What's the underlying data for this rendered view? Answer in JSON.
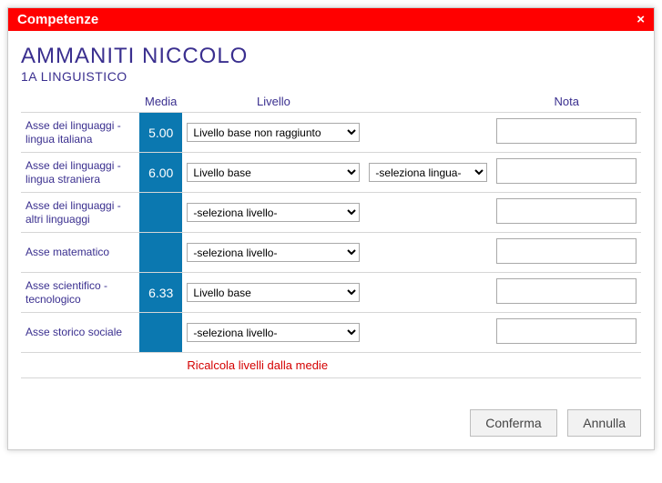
{
  "dialog": {
    "title": "Competenze",
    "close_glyph": "×"
  },
  "student": {
    "name": "AMMANITI NICCOLO",
    "class": "1A LINGUISTICO"
  },
  "headers": {
    "media": "Media",
    "livello": "Livello",
    "nota": "Nota"
  },
  "rows": [
    {
      "axis": "Asse dei linguaggi - lingua italiana",
      "media": "5.00",
      "level": "Livello base non raggiunto",
      "lang": "",
      "note": ""
    },
    {
      "axis": "Asse dei linguaggi - lingua straniera",
      "media": "6.00",
      "level": "Livello base",
      "lang": "-seleziona lingua-",
      "note": ""
    },
    {
      "axis": "Asse dei linguaggi - altri linguaggi",
      "media": "",
      "level": "-seleziona livello-",
      "lang": "",
      "note": ""
    },
    {
      "axis": "Asse matematico",
      "media": "",
      "level": "-seleziona livello-",
      "lang": "",
      "note": ""
    },
    {
      "axis": "Asse scientifico - tecnologico",
      "media": "6.33",
      "level": "Livello base",
      "lang": "",
      "note": ""
    },
    {
      "axis": "Asse storico sociale",
      "media": "",
      "level": "-seleziona livello-",
      "lang": "",
      "note": ""
    }
  ],
  "recalc_label": "Ricalcola livelli dalla medie",
  "buttons": {
    "confirm": "Conferma",
    "cancel": "Annulla"
  }
}
